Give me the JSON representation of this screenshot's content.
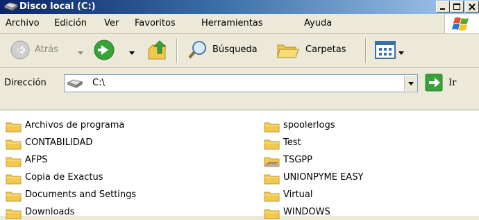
{
  "window": {
    "title": "Disco local (C:)",
    "controls": [
      "minimize",
      "maximize",
      "close"
    ]
  },
  "menu": {
    "items": [
      "Archivo",
      "Edición",
      "Ver",
      "Favoritos",
      "Herramientas",
      "Ayuda"
    ]
  },
  "toolbar": {
    "back_label": "Atrás",
    "search_label": "Búsqueda",
    "folders_label": "Carpetas"
  },
  "address": {
    "label": "Dirección",
    "value": "C:\\",
    "go_label": "Ir"
  },
  "files": {
    "left": [
      {
        "name": "Archivos de programa",
        "icon": "folder-icon"
      },
      {
        "name": "CONTABILIDAD",
        "icon": "folder-icon"
      },
      {
        "name": "AFPS",
        "icon": "folder-icon"
      },
      {
        "name": "Copia de Exactus",
        "icon": "folder-icon"
      },
      {
        "name": "Documents and Settings",
        "icon": "folder-icon"
      },
      {
        "name": "Downloads",
        "icon": "folder-icon"
      }
    ],
    "right": [
      {
        "name": "spoolerlogs",
        "icon": "folder-icon"
      },
      {
        "name": "Test",
        "icon": "folder-icon"
      },
      {
        "name": "TSGPP",
        "icon": "shared-folder-icon"
      },
      {
        "name": "UNIONPYME EASY",
        "icon": "folder-icon"
      },
      {
        "name": "Virtual",
        "icon": "folder-icon"
      },
      {
        "name": "WINDOWS",
        "icon": "folder-icon"
      }
    ]
  },
  "colors": {
    "titlebar_start": "#0a246a",
    "titlebar_end": "#a6caf0",
    "chrome": "#ece9d8",
    "folder": "#f2c94c"
  }
}
